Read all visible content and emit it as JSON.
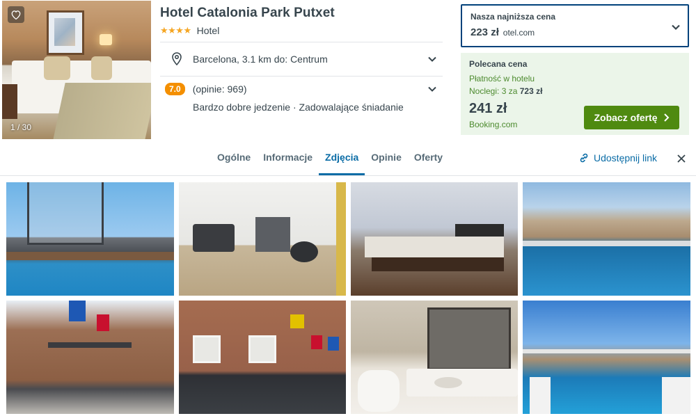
{
  "hero": {
    "counter": "1 / 30"
  },
  "hotel": {
    "name": "Hotel Catalonia Park Putxet",
    "stars": "★★★★",
    "type": "Hotel",
    "location": "Barcelona, 3.1 km do: Centrum",
    "rating_score": "7.0",
    "rating_count": "(opinie: 969)",
    "rating_desc": "Bardzo dobre jedzenie · Zadowalające śniadanie"
  },
  "lowest_price": {
    "label": "Nasza najniższa cena",
    "price": "223 zł",
    "provider": "otel.com"
  },
  "recommended": {
    "label": "Polecana cena",
    "payment": "Płatność w hotelu",
    "nights_prefix": "Noclegi: 3 za",
    "nights_total": "723 zł",
    "price": "241 zł",
    "provider": "Booking.com",
    "cta": "Zobacz ofertę"
  },
  "tabs": [
    "Ogólne",
    "Informacje",
    "Zdjęcia",
    "Opinie",
    "Oferty"
  ],
  "active_tab": "Zdjęcia",
  "share_label": "Udostępnij link",
  "colors": {
    "accent": "#0a6ca6",
    "cta": "#4f8a10",
    "rating": "#f48f00",
    "highlight_border": "#00427b",
    "reco_bg": "#ebf5e9"
  }
}
